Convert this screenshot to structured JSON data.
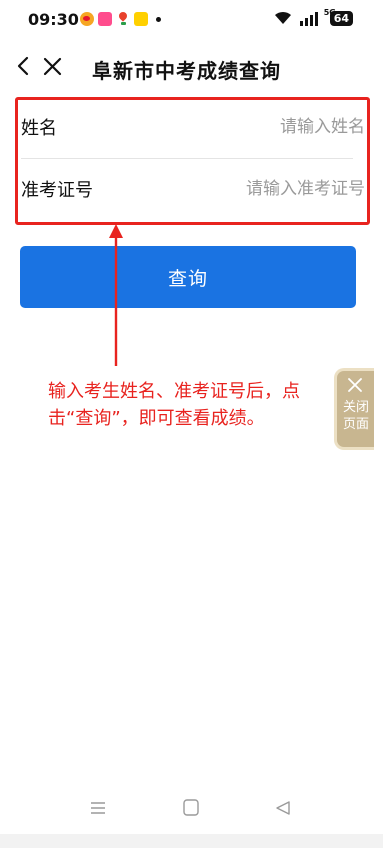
{
  "status_bar": {
    "time": "09:30",
    "network": "5G",
    "battery": "64"
  },
  "header": {
    "title": "阜新市中考成绩查询"
  },
  "form": {
    "name_label": "姓名",
    "name_placeholder": "请输入姓名",
    "name_value": "",
    "ticket_label": "准考证号",
    "ticket_placeholder": "请输入准考证号",
    "ticket_value": ""
  },
  "query_button": {
    "label": "查询"
  },
  "annotation": {
    "text": "输入考生姓名、准考证号后，点击“查询”，即可查看成绩。",
    "color": "#e8231f"
  },
  "side_panel": {
    "label": "关闭页面"
  },
  "icons": {
    "back": "chevron-left-icon",
    "close": "close-icon",
    "menu": "menu-icon",
    "home": "home-icon",
    "nav_back": "triangle-back-icon"
  },
  "colors": {
    "primary": "#1a73e2",
    "highlight": "#e8231f",
    "side_panel": "#c8b690"
  }
}
